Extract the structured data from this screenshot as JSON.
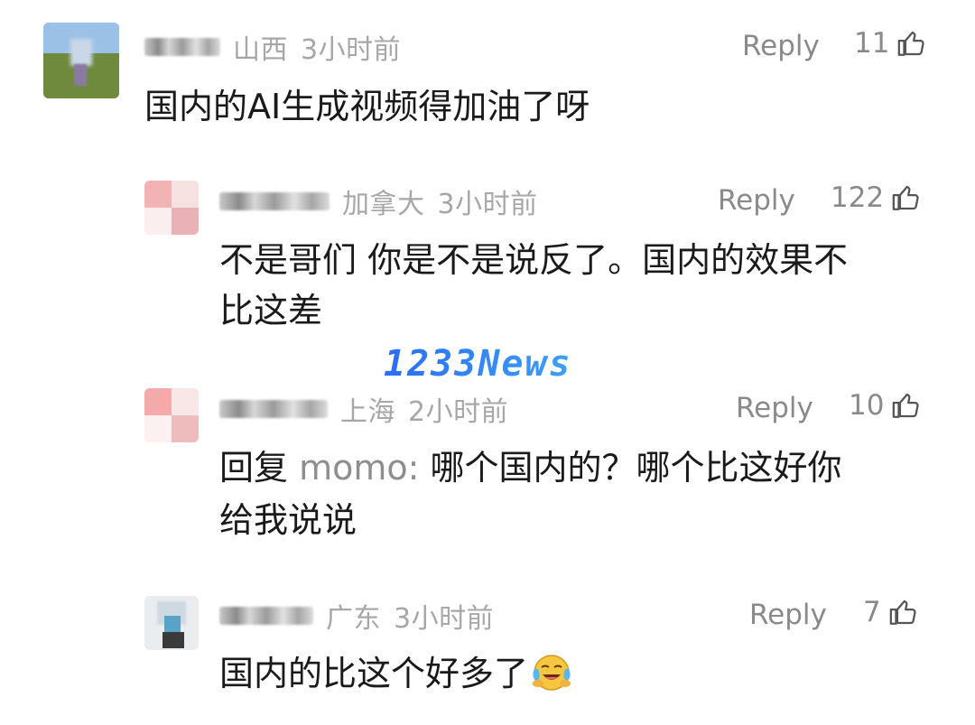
{
  "comments": [
    {
      "location": "山西",
      "time": "3小时前",
      "reply_label": "Reply",
      "likes": "11",
      "text": "国内的AI生成视频得加油了呀"
    },
    {
      "location": "加拿大",
      "time": "3小时前",
      "reply_label": "Reply",
      "likes": "122",
      "text_line1": "不是哥们 你是不是说反了。国内的效果不",
      "text_line2": "比这差"
    },
    {
      "location": "上海",
      "time": "2小时前",
      "reply_label": "Reply",
      "likes": "10",
      "text_prefix": "回复",
      "reply_to": "momo:",
      "text_rest": "哪个国内的？哪个比这好你",
      "text_line2": "给我说说"
    },
    {
      "location": "广东",
      "time": "3小时前",
      "reply_label": "Reply",
      "likes": "7",
      "text": "国内的比这个好多了",
      "emoji": "laughing-crying-face-icon"
    }
  ],
  "watermark": "1233News",
  "colors": {
    "meta_gray": "#a7a7a7",
    "action_gray": "#8a8a8a",
    "text_dark": "#1a1a1a"
  }
}
